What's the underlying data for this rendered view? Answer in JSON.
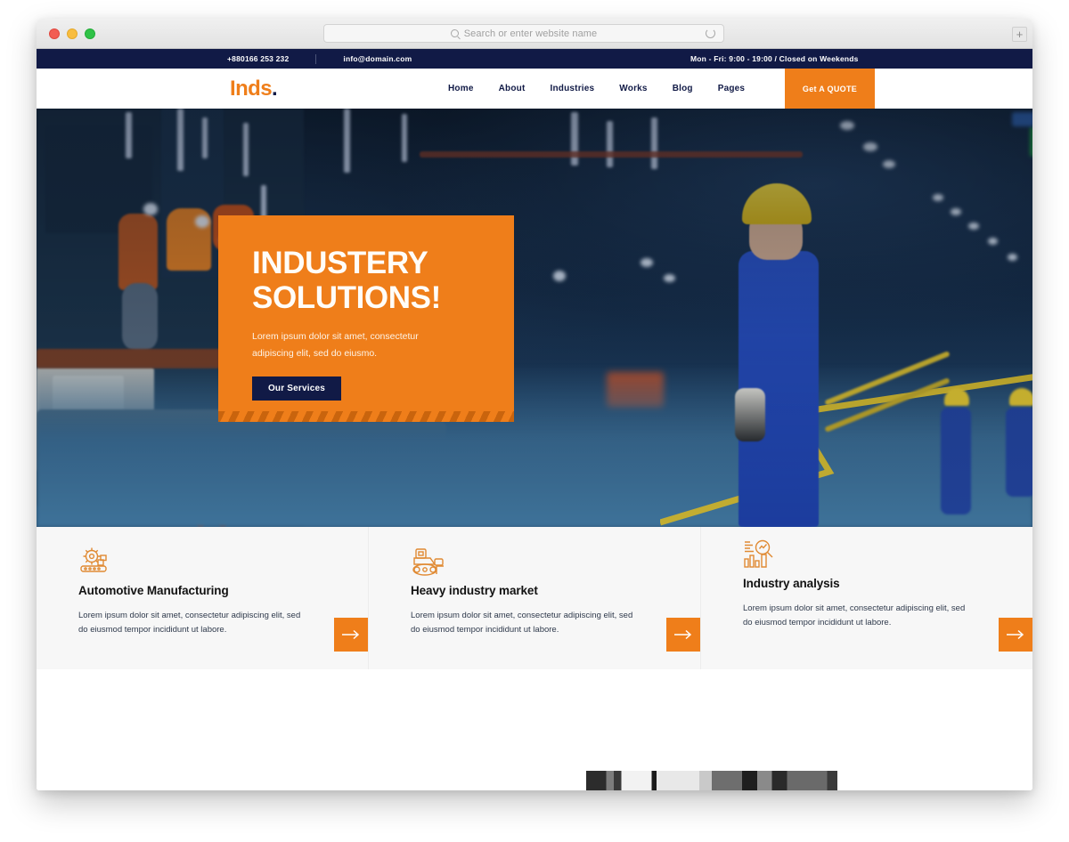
{
  "browser": {
    "search": {
      "placeholder": "Search or enter website name",
      "icon": "search-icon",
      "reload_icon": "reload-icon"
    },
    "new_tab_label": "+",
    "traffic_lights": [
      "close",
      "minimize",
      "zoom"
    ]
  },
  "topbar": {
    "phone": "+880166 253 232",
    "email": "info@domain.com",
    "hours": "Mon - Fri: 9:00 - 19:00 / Closed on Weekends"
  },
  "header": {
    "logo_text": "Inds",
    "logo_dot": ".",
    "nav": [
      {
        "label": "Home"
      },
      {
        "label": "About"
      },
      {
        "label": "Industries"
      },
      {
        "label": "Works"
      },
      {
        "label": "Blog"
      },
      {
        "label": "Pages"
      }
    ],
    "quote_button": "Get A QUOTE"
  },
  "hero": {
    "title_line1": "INDUSTERY",
    "title_line2": "SOLUTIONS!",
    "paragraph": "Lorem ipsum dolor sit amet, consectetur adipiscing elit, sed do eiusmo.",
    "button": "Our Services"
  },
  "cards": [
    {
      "icon": "gear-conveyor-icon",
      "title": "Automotive Manufacturing",
      "text": "Lorem ipsum dolor sit amet, consectetur adipiscing elit, sed do eiusmod tempor incididunt ut labore.",
      "arrow": "arrow-right-icon"
    },
    {
      "icon": "bulldozer-icon",
      "title": "Heavy industry market",
      "text": "Lorem ipsum dolor sit amet, consectetur adipiscing elit, sed do eiusmod tempor incididunt ut labore.",
      "arrow": "arrow-right-icon"
    },
    {
      "icon": "chart-magnifier-icon",
      "title": "Industry analysis",
      "text": "Lorem ipsum dolor sit amet, consectetur adipiscing elit, sed do eiusmod tempor incididunt ut labore.",
      "arrow": "arrow-right-icon"
    }
  ],
  "colors": {
    "accent_orange": "#ef7e1a",
    "navy": "#111a46",
    "card_bg": "#f7f7f7",
    "text_dark": "#121212"
  }
}
